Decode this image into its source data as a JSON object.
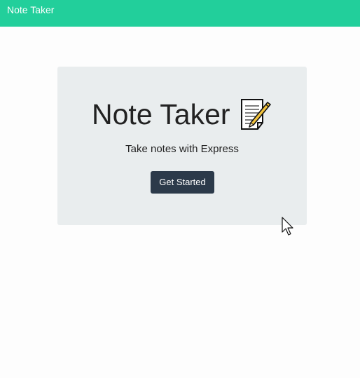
{
  "navbar": {
    "brand": "Note Taker"
  },
  "hero": {
    "title": "Note Taker",
    "title_icon": "memo-icon",
    "subtitle": "Take notes with Express",
    "cta_label": "Get Started"
  },
  "colors": {
    "navbar": "#22cf9b",
    "hero_background": "#e9edee",
    "button": "#2c3a4a"
  },
  "cursor_icon": "mouse-pointer-icon"
}
